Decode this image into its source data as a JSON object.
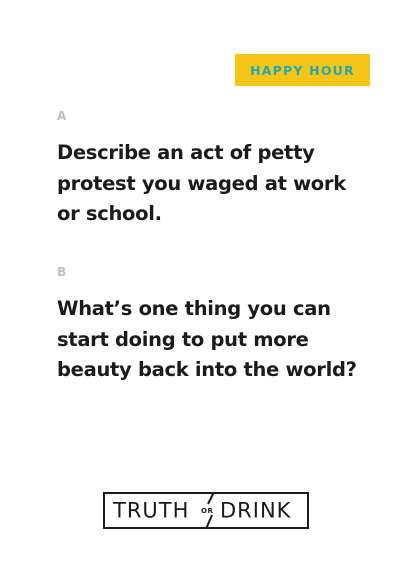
{
  "colors": {
    "badge_bg": "#f5c518",
    "badge_text": "#27a7b6",
    "question_text": "#1b1b1b",
    "letter_label": "#bdbdbd"
  },
  "badge": {
    "label": "HAPPY HOUR"
  },
  "questions": [
    {
      "letter": "A",
      "text": "Describe an act of petty protest you waged at work or school."
    },
    {
      "letter": "B",
      "text": "What’s one thing you can start doing to put more beauty back into the world?"
    }
  ],
  "logo": {
    "left_word": "TRUTH",
    "connector": "OR",
    "right_word": "DRINK"
  }
}
